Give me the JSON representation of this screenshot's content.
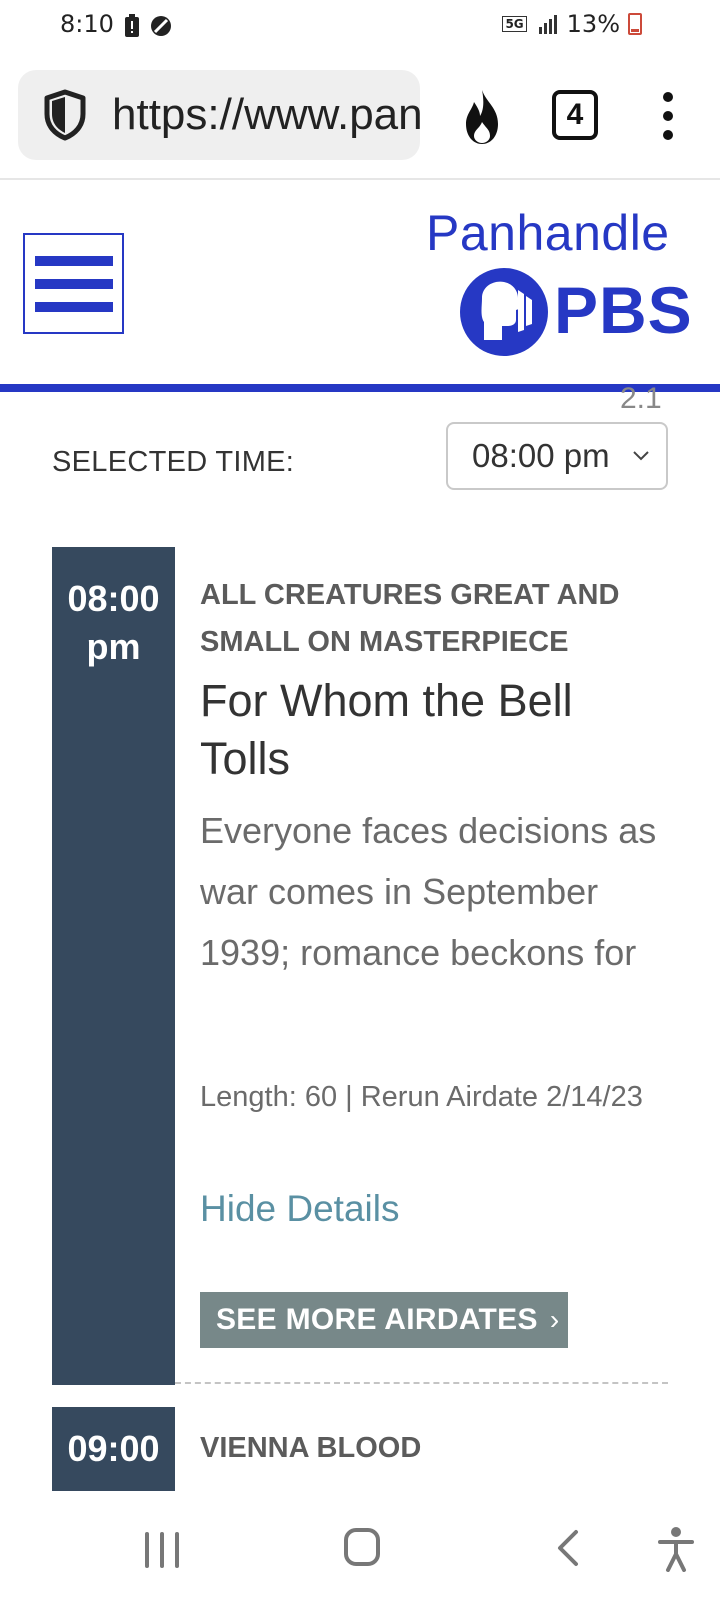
{
  "status_bar": {
    "time": "8:10",
    "network": "5G",
    "battery_text": "13%"
  },
  "browser": {
    "url": "https://www.panhandlepbs.org",
    "tab_count": "4"
  },
  "site_header": {
    "logo_name": "Panhandle",
    "logo_brand": "PBS",
    "accent_color": "#2638c4"
  },
  "schedule": {
    "clipped_channel": "2.1",
    "selected_time_label": "SELECTED TIME:",
    "selected_time_value": "08:00 pm",
    "items": [
      {
        "time": "08:00",
        "ampm": "pm",
        "series": "ALL CREATURES GREAT AND SMALL ON MASTERPIECE",
        "title": "For Whom the Bell Tolls",
        "description": "Everyone faces decisions as war comes in September 1939; romance beckons for",
        "length_info": "Length: 60 | Rerun Airdate 2/14/23",
        "hide_details": "Hide Details",
        "see_more": "SEE MORE AIRDATES"
      },
      {
        "time": "09:00",
        "series": "VIENNA BLOOD"
      }
    ]
  }
}
